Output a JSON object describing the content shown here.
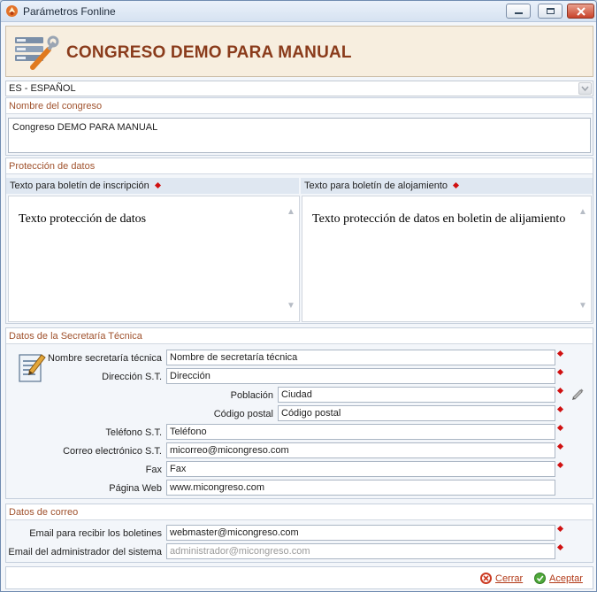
{
  "window": {
    "title": "Parámetros Fonline"
  },
  "header": {
    "title": "CONGRESO DEMO PARA MANUAL"
  },
  "language": {
    "selected": "ES - ESPAÑOL"
  },
  "congress": {
    "section_title": "Nombre del congreso",
    "value": "Congreso DEMO PARA MANUAL"
  },
  "data_protection": {
    "section_title": "Protección de datos",
    "registration_label": "Texto para boletín de inscripción",
    "registration_text": "Texto protección de datos",
    "accommodation_label": "Texto para boletín de alojamiento",
    "accommodation_text": "Texto protección de datos en boletin de alijamiento"
  },
  "secretariat": {
    "section_title": "Datos de la Secretaría Técnica",
    "name_label": "Nombre secretaría técnica",
    "name_value": "Nombre de secretaría técnica",
    "address_label": "Dirección S.T.",
    "address_value": "Dirección",
    "city_label": "Población",
    "city_value": "Ciudad",
    "postal_label": "Código postal",
    "postal_value": "Código postal",
    "phone_label": "Teléfono S.T.",
    "phone_value": "Teléfono",
    "email_label": "Correo electrónico S.T.",
    "email_value": "micorreo@micongreso.com",
    "fax_label": "Fax",
    "fax_value": "Fax",
    "web_label": "Página Web",
    "web_value": "www.micongreso.com"
  },
  "mail": {
    "section_title": "Datos de correo",
    "bulletins_label": "Email para recibir los boletines",
    "bulletins_value": "webmaster@micongreso.com",
    "admin_label": "Email del administrador del sistema",
    "admin_placeholder": "administrador@micongreso.com"
  },
  "footer": {
    "close_label": "Cerrar",
    "accept_label": "Aceptar"
  },
  "colors": {
    "accent": "#8a3b1b",
    "section_title": "#a0522d",
    "required": "#d01010"
  }
}
